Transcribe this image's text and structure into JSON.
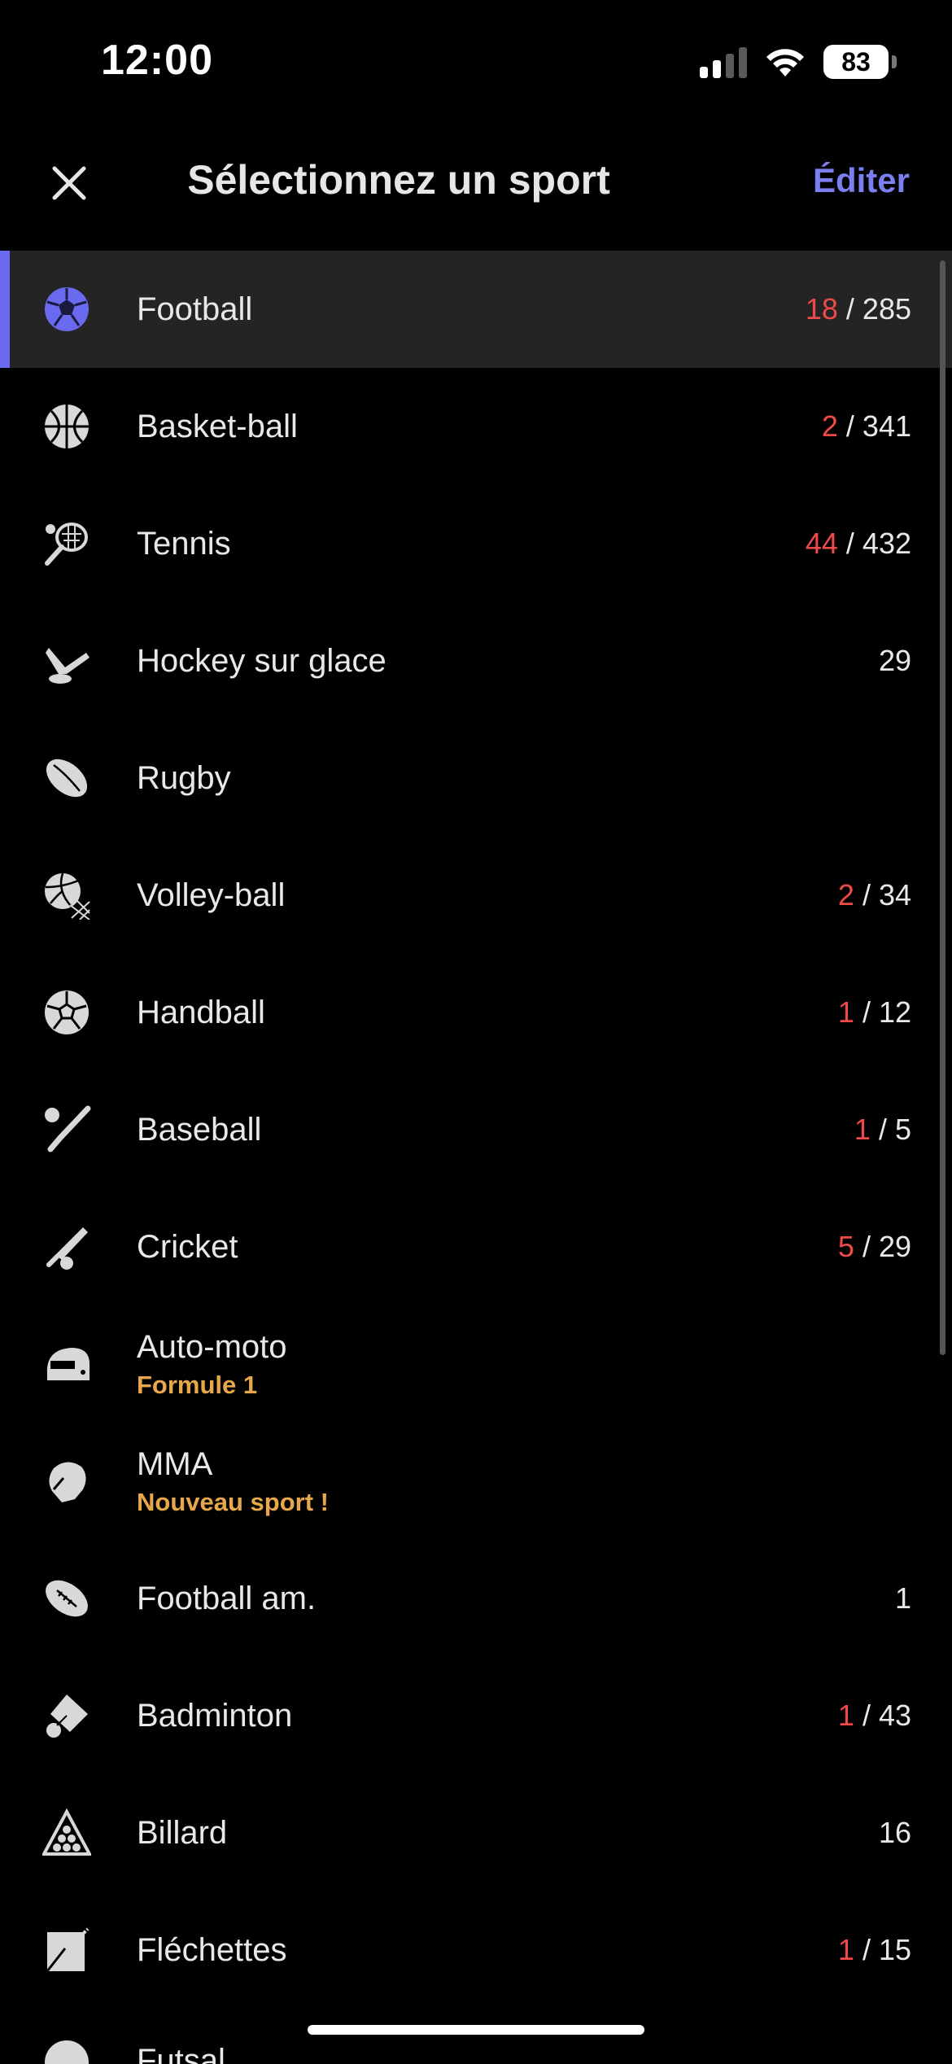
{
  "status_bar": {
    "time": "12:00",
    "battery": "83"
  },
  "header": {
    "title": "Sélectionnez un sport",
    "edit_label": "Éditer"
  },
  "colors": {
    "accent": "#6a6af0",
    "live": "#ef4a4a",
    "subtitle": "#e8a84a"
  },
  "sports": [
    {
      "name": "Football",
      "icon": "football-icon",
      "live": "18",
      "total": "285",
      "selected": true
    },
    {
      "name": "Basket-ball",
      "icon": "basketball-icon",
      "live": "2",
      "total": "341"
    },
    {
      "name": "Tennis",
      "icon": "tennis-icon",
      "live": "44",
      "total": "432"
    },
    {
      "name": "Hockey sur glace",
      "icon": "hockey-icon",
      "total": "29"
    },
    {
      "name": "Rugby",
      "icon": "rugby-icon"
    },
    {
      "name": "Volley-ball",
      "icon": "volleyball-icon",
      "live": "2",
      "total": "34"
    },
    {
      "name": "Handball",
      "icon": "handball-icon",
      "live": "1",
      "total": "12"
    },
    {
      "name": "Baseball",
      "icon": "baseball-icon",
      "live": "1",
      "total": "5"
    },
    {
      "name": "Cricket",
      "icon": "cricket-icon",
      "live": "5",
      "total": "29"
    },
    {
      "name": "Auto-moto",
      "icon": "helmet-icon",
      "subtitle": "Formule 1"
    },
    {
      "name": "MMA",
      "icon": "boxing-glove-icon",
      "subtitle": "Nouveau sport !"
    },
    {
      "name": "Football am.",
      "icon": "american-football-icon",
      "total": "1"
    },
    {
      "name": "Badminton",
      "icon": "shuttlecock-icon",
      "live": "1",
      "total": "43"
    },
    {
      "name": "Billard",
      "icon": "billiard-icon",
      "total": "16"
    },
    {
      "name": "Fléchettes",
      "icon": "darts-icon",
      "live": "1",
      "total": "15"
    }
  ]
}
